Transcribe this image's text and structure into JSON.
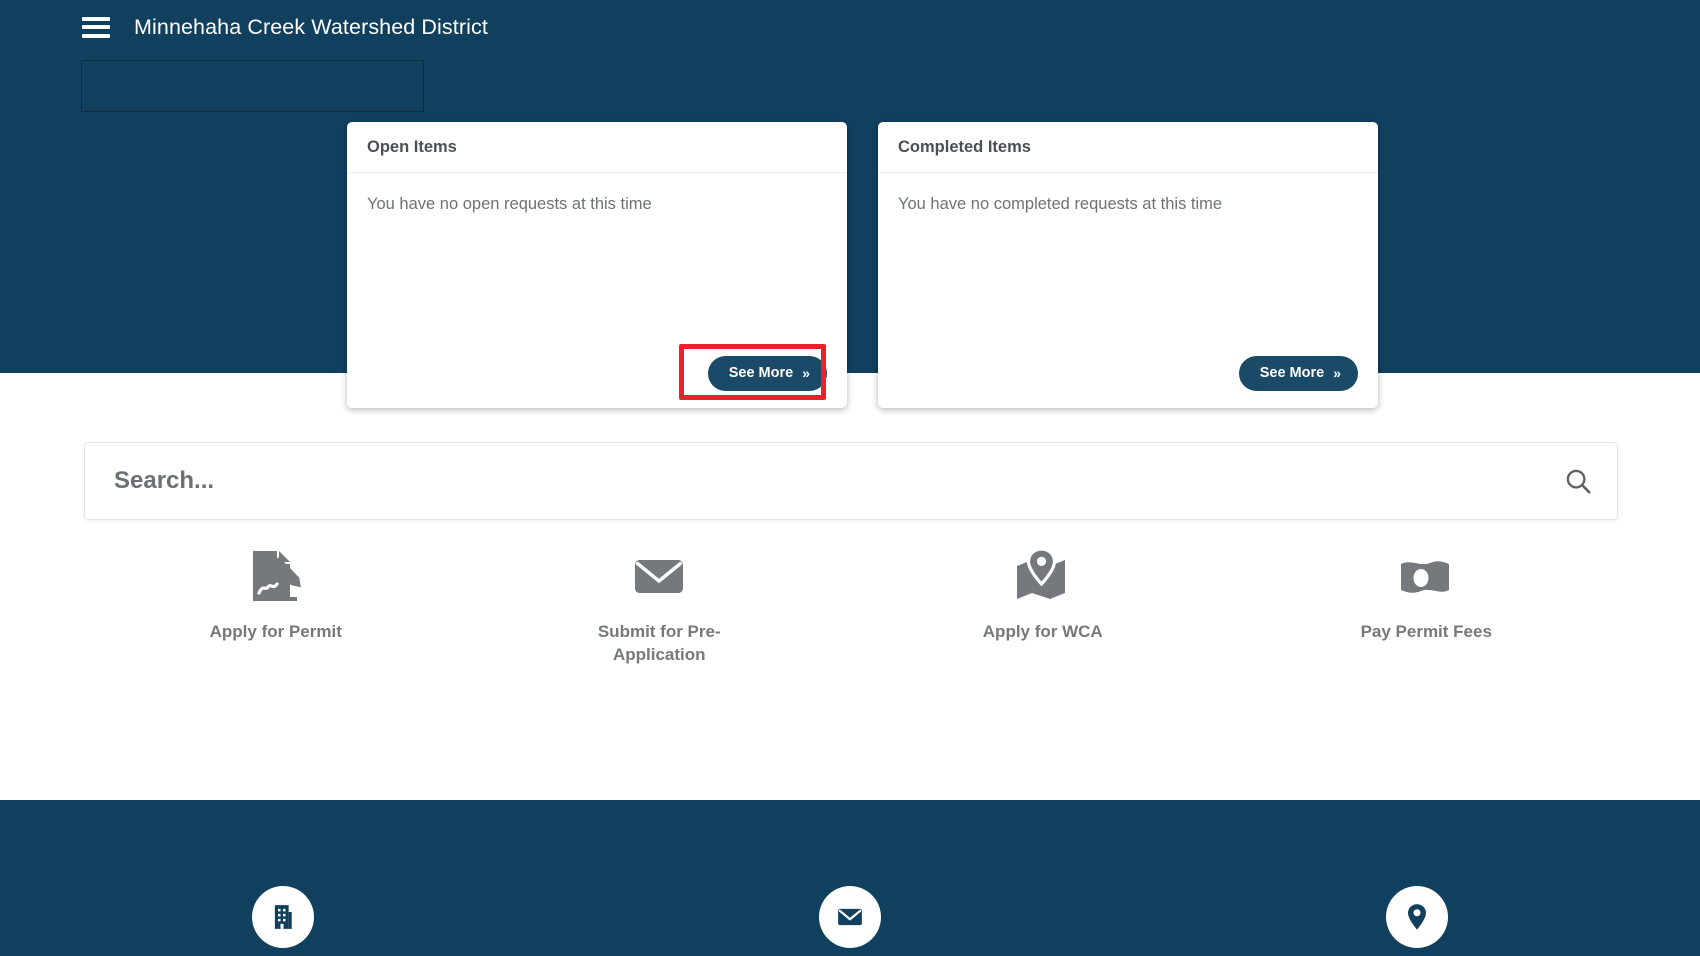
{
  "header": {
    "menu_icon": "hamburger-menu-icon",
    "title": "Minnehaha Creek Watershed District"
  },
  "hero": {
    "background_color": "#11405e",
    "logo_placeholder": ""
  },
  "cards": [
    {
      "title": "Open Items",
      "empty_text": "You have no open requests at this time",
      "button_label": "See More",
      "button_chevron": "»",
      "highlighted": true
    },
    {
      "title": "Completed Items",
      "empty_text": "You have no completed requests at this time",
      "button_label": "See More",
      "button_chevron": "»",
      "highlighted": false
    }
  ],
  "search": {
    "placeholder": "Search...",
    "value": "",
    "icon": "search-icon"
  },
  "quick_actions": [
    {
      "label": "Apply for Permit",
      "icon": "document-pencil-icon"
    },
    {
      "label": "Submit for Pre-Application",
      "icon": "envelope-icon"
    },
    {
      "label": "Apply for WCA",
      "icon": "map-pin-icon"
    },
    {
      "label": "Pay Permit Fees",
      "icon": "money-bill-icon"
    }
  ],
  "footer": {
    "background_color": "#11405e",
    "items": [
      {
        "icon": "building-icon"
      },
      {
        "icon": "envelope-icon"
      },
      {
        "icon": "location-pin-icon"
      }
    ]
  },
  "colors": {
    "brand_navy": "#11405e",
    "button_navy": "#1b4a68",
    "highlight_red": "#e8232a",
    "icon_gray": "#75797d",
    "text_gray": "#6d7276"
  }
}
